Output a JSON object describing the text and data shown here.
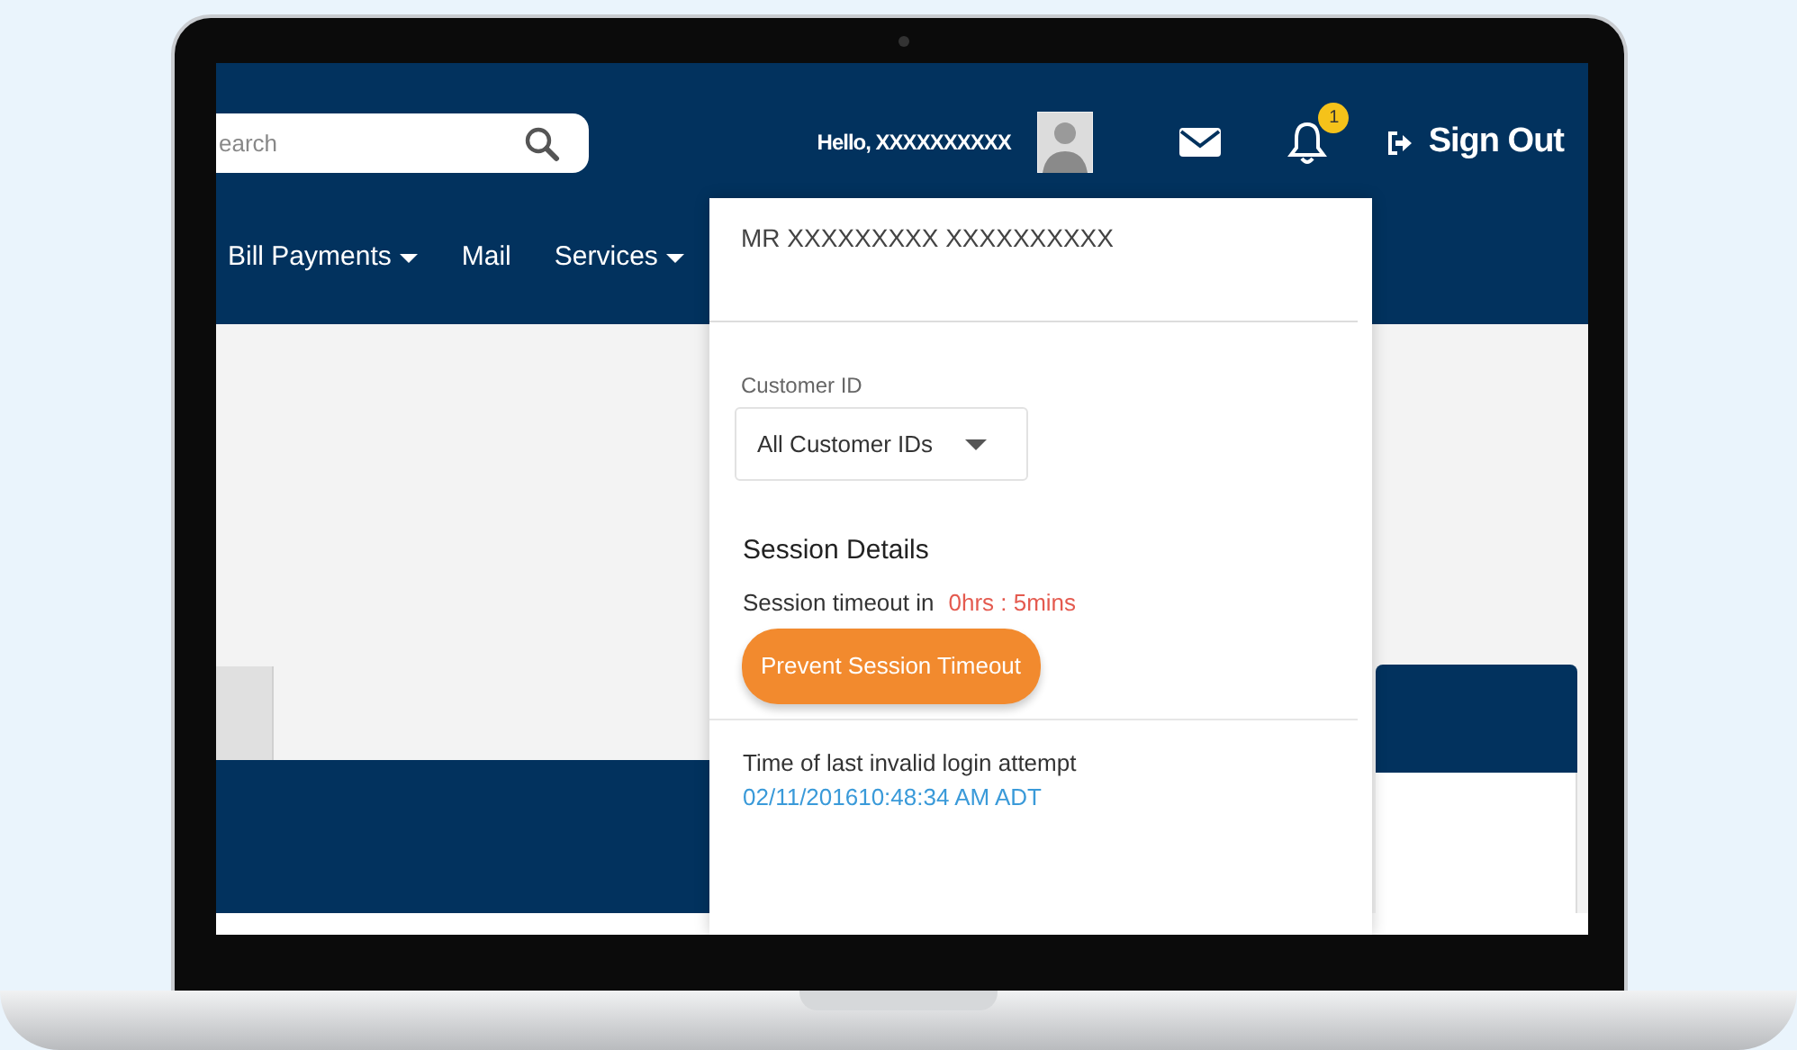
{
  "header": {
    "search": {
      "placeholder": "earch"
    },
    "greeting": "Hello, XXXXXXXXXX",
    "notification_count": "1",
    "sign_out": "Sign Out"
  },
  "nav": [
    {
      "label": "Bill Payments",
      "dropdown": true
    },
    {
      "label": "Mail",
      "dropdown": false
    },
    {
      "label": "Services",
      "dropdown": true
    }
  ],
  "account_menu": {
    "name": "MR XXXXXXXXX XXXXXXXXXX",
    "customer_id": {
      "label": "Customer ID",
      "value": "All Customer IDs"
    },
    "session": {
      "title": "Session Details",
      "timeout_label": "Session timeout in",
      "timeout_value": "0hrs : 5mins",
      "button": "Prevent Session Timeout"
    },
    "last_invalid_login": {
      "label": "Time of last invalid login attempt",
      "time": "02/11/201610:48:34 AM ADT"
    }
  }
}
